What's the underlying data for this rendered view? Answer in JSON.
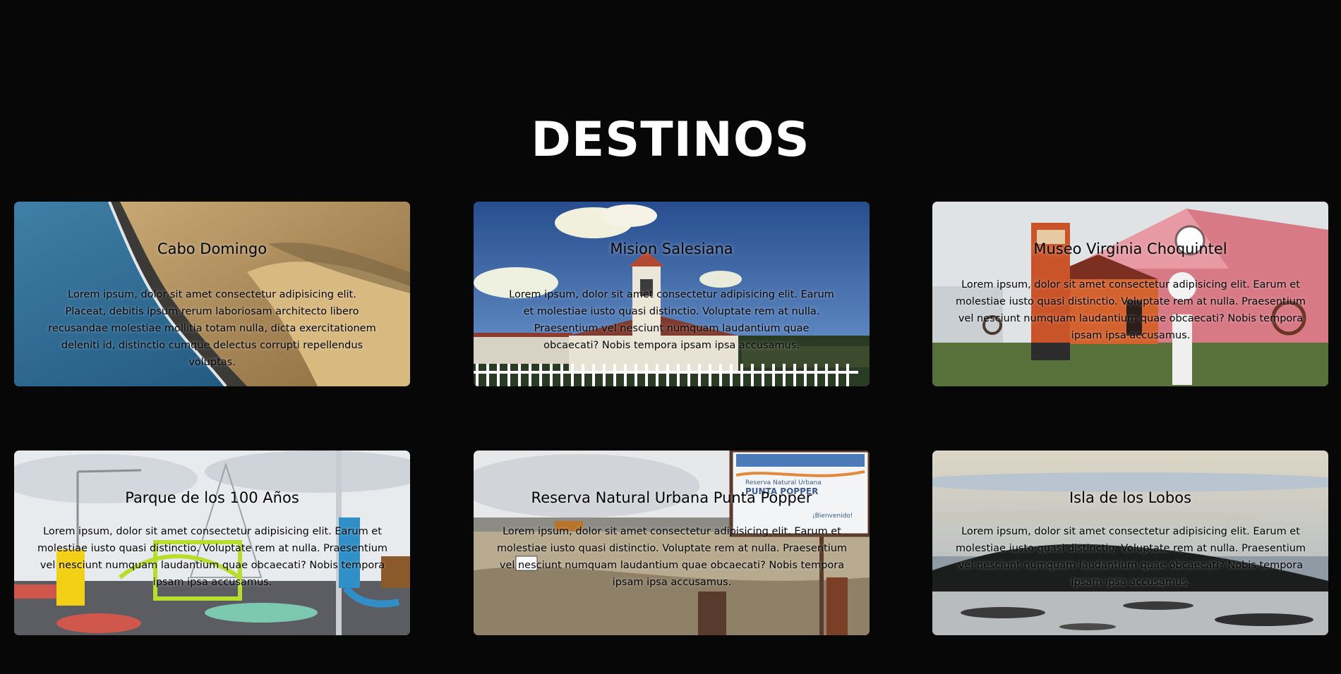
{
  "page": {
    "title": "DESTINOS"
  },
  "cards": [
    {
      "title": "Cabo Domingo",
      "text": "Lorem ipsum, dolor sit amet consectetur adipisicing elit. Placeat, debitis ipsum rerum laboriosam architecto libero recusandae molestiae mollitia totam nulla, dicta exercitationem deleniti id, distinctio cumque delectus corrupti repellendus voluptas.",
      "image": "coastal-cliff-aerial"
    },
    {
      "title": "Mision Salesiana",
      "text": "Lorem ipsum, dolor sit amet consectetur adipisicing elit. Earum et molestiae iusto quasi distinctio. Voluptate rem at nulla. Praesentium vel nesciunt numquam laudantium quae obcaecati? Nobis tempora ipsam ipsa accusamus.",
      "image": "white-church-tower"
    },
    {
      "title": "Museo Virginia Choquintel",
      "text": "Lorem ipsum, dolor sit amet consectetur adipisicing elit. Earum et molestiae iusto quasi distinctio. Voluptate rem at nulla. Praesentium vel nesciunt numquam laudantium quae obcaecati? Nobis tempora ipsam ipsa accusamus.",
      "image": "pink-museum-building"
    },
    {
      "title": "Parque de los 100 Años",
      "text": "Lorem ipsum, dolor sit amet consectetur adipisicing elit. Earum et molestiae iusto quasi distinctio. Voluptate rem at nulla. Praesentium vel nesciunt numquam laudantium quae obcaecati? Nobis tempora ipsam ipsa accusamus.",
      "image": "colorful-playground"
    },
    {
      "title": "Reserva Natural Urbana Punta Popper",
      "text": "Lorem ipsum, dolor sit amet consectetur adipisicing elit. Earum et molestiae iusto quasi distinctio. Voluptate rem at nulla. Praesentium vel nesciunt numquam laudantium quae obcaecati? Nobis tempora ipsam ipsa accusamus.",
      "image": "reserve-sign-beach",
      "sign_lines": [
        "Reserva Natural Urbana",
        "PUNTA POPPER",
        "¡Bienvenido!"
      ]
    },
    {
      "title": "Isla de los Lobos",
      "text": "Lorem ipsum, dolor sit amet consectetur adipisicing elit. Earum et molestiae iusto quasi distinctio. Voluptate rem at nulla. Praesentium vel nesciunt numquam laudantium quae obcaecati? Nobis tempora ipsam ipsa accusamus.",
      "image": "rocky-island-shore"
    }
  ]
}
